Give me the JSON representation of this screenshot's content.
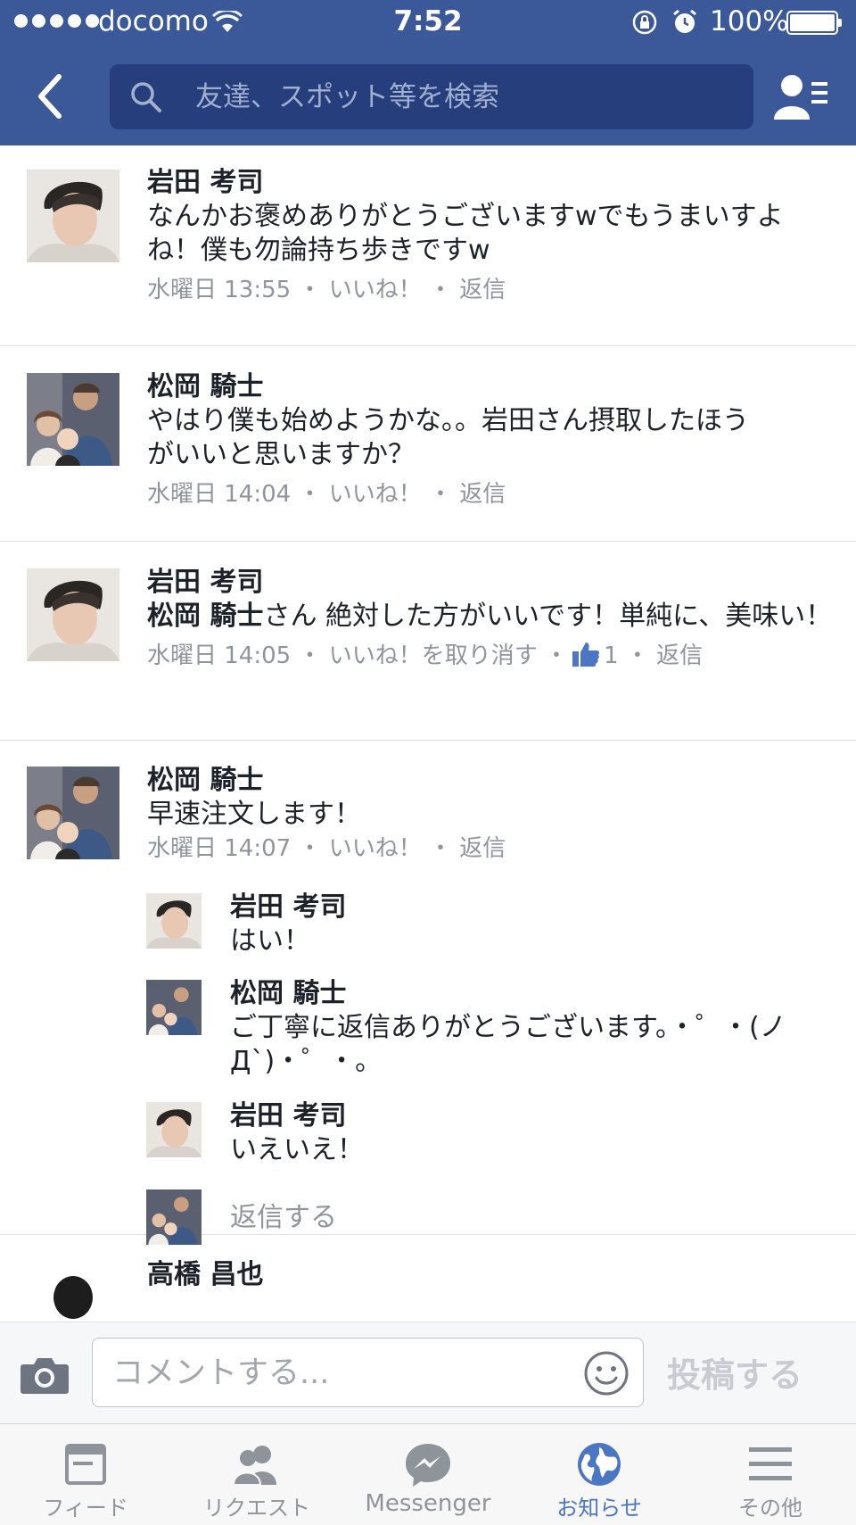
{
  "status_bar": {
    "carrier": "docomo",
    "time": "7:52",
    "battery": "100%"
  },
  "header": {
    "search_placeholder": "友達、スポット等を検索"
  },
  "comments": [
    {
      "author": "岩田 考司",
      "text": "なんかお褒めありがとうございますwでもうまいすよね！僕も勿論持ち歩きですw",
      "time": "水曜日 13:55",
      "like_label": "いいね！",
      "reply_label": "返信"
    },
    {
      "author": "松岡 騎士",
      "text": "やはり僕も始めようかな。。岩田さん摂取したほうがいいと思いますか？",
      "time": "水曜日 14:04",
      "like_label": "いいね！",
      "reply_label": "返信"
    },
    {
      "author": "岩田 考司",
      "mention": "松岡 騎士",
      "text": "さん 絶対した方がいいです！単純に、美味い！",
      "time": "水曜日 14:05",
      "like_label": "いいね！を取り消す",
      "like_count": "1",
      "reply_label": "返信"
    },
    {
      "author": "松岡 騎士",
      "text": "早速注文します！",
      "time": "水曜日 14:07",
      "like_label": "いいね！",
      "reply_label": "返信"
    }
  ],
  "replies": [
    {
      "author": "岩田 考司",
      "text": "はい！"
    },
    {
      "author": "松岡 騎士",
      "text": "ご丁寧に返信ありがとうございます。・゜・(ノД`)・゜・。"
    },
    {
      "author": "岩田 考司",
      "text": "いえいえ！"
    }
  ],
  "reply_prompt": "返信する",
  "next_comment_author": "高橋 昌也",
  "composer": {
    "placeholder": "コメントする...",
    "post_label": "投稿する"
  },
  "tabs": [
    {
      "label": "フィード",
      "icon": "feed-icon"
    },
    {
      "label": "リクエスト",
      "icon": "friend-requests-icon"
    },
    {
      "label": "Messenger",
      "icon": "messenger-icon"
    },
    {
      "label": "お知らせ",
      "icon": "notifications-globe-icon",
      "active": true
    },
    {
      "label": "その他",
      "icon": "menu-icon"
    }
  ],
  "colors": {
    "header_bg": "#3b5998",
    "search_bg": "#263f7c",
    "active_tab": "#4a76c4",
    "meta_text": "#90949c"
  }
}
